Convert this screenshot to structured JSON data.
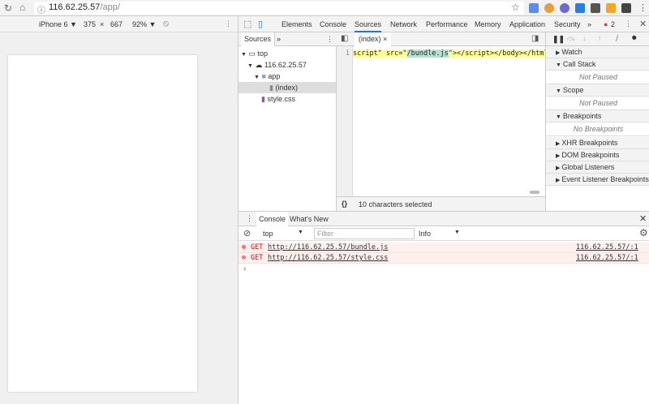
{
  "browser": {
    "url_host": "116.62.25.57",
    "url_path": "/app/"
  },
  "device_toolbar": {
    "device": "iPhone 6 ▼",
    "width": "375",
    "x": "×",
    "height": "667",
    "zoom": "92% ▼"
  },
  "devtools": {
    "tabs": [
      "Elements",
      "Console",
      "Sources",
      "Network",
      "Performance",
      "Memory",
      "Application",
      "Security"
    ],
    "active_tab": "Sources",
    "more": "»",
    "error_count": "2"
  },
  "navigator": {
    "tab": "Sources",
    "more": "»",
    "tree": [
      {
        "label": "top",
        "level": 0
      },
      {
        "label": "116.62.25.57",
        "level": 1
      },
      {
        "label": "app",
        "level": 2
      },
      {
        "label": "(index)",
        "level": 3,
        "selected": true
      },
      {
        "label": "style.css",
        "level": 2
      }
    ]
  },
  "editor": {
    "file_tab": "(index)",
    "line_number": "1",
    "code_before": "script\" src=\"",
    "code_selected": "/bundle.js",
    "code_after": "\"></script></body></html>",
    "status": "10 characters selected",
    "format_icon": "{}"
  },
  "debugger": {
    "sections": [
      {
        "label": "Watch"
      },
      {
        "label": "Call Stack",
        "content": "Not Paused"
      },
      {
        "label": "Scope",
        "content": "Not Paused"
      },
      {
        "label": "Breakpoints",
        "content": "No Breakpoints"
      },
      {
        "label": "XHR Breakpoints"
      },
      {
        "label": "DOM Breakpoints"
      },
      {
        "label": "Global Listeners"
      },
      {
        "label": "Event Listener Breakpoints"
      }
    ]
  },
  "console": {
    "tabs": [
      "Console",
      "What's New"
    ],
    "context": "top",
    "filter_placeholder": "Filter",
    "level": "Info",
    "messages": [
      {
        "method": "GET",
        "url": "http://116.62.25.57/bundle.js",
        "source": "116.62.25.57/:1"
      },
      {
        "method": "GET",
        "url": "http://116.62.25.57/style.css",
        "source": "116.62.25.57/:1"
      }
    ],
    "prompt": "›"
  },
  "colors": {
    "accent": "#1a73e8",
    "error": "#e53935",
    "selection": "#b8e0d2"
  }
}
